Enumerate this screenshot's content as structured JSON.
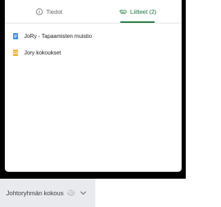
{
  "tabs": {
    "details_label": "Tiedot",
    "attachments_label": "Liitteet (2)"
  },
  "attachments": [
    {
      "title": "JoRy - Tapaamisten muistio",
      "icon": "docs-icon",
      "color": "#4285f4"
    },
    {
      "title": "Jory kokoukset",
      "icon": "slides-icon",
      "color": "#f4b400"
    }
  ],
  "footer": {
    "event_title": "Johtoryhmän kokous"
  },
  "colors": {
    "accent": "#137333",
    "docs_blue": "#4285f4",
    "slides_yellow": "#f4b400"
  }
}
